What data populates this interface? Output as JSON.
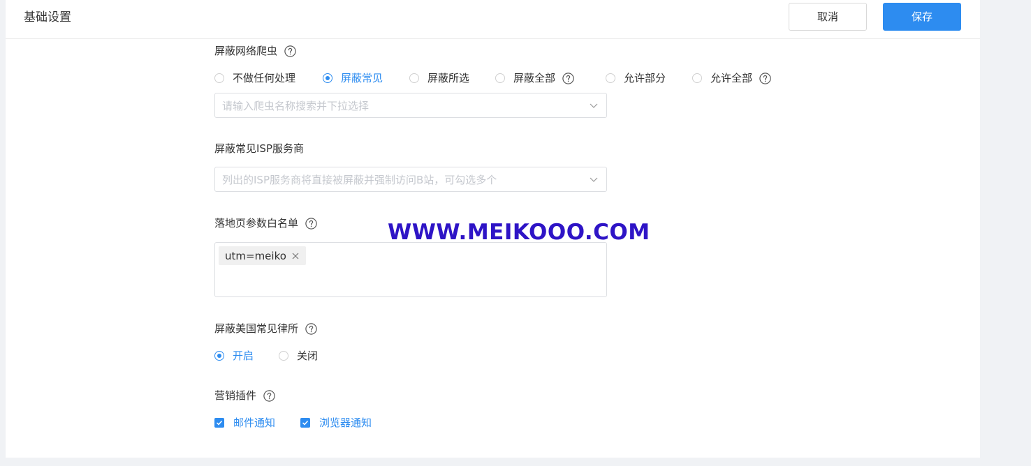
{
  "header": {
    "title": "基础设置",
    "cancel_label": "取消",
    "save_label": "保存"
  },
  "crawler": {
    "label": "屏蔽网络爬虫",
    "options": [
      "不做任何处理",
      "屏蔽常见",
      "屏蔽所选",
      "屏蔽全部",
      "允许部分",
      "允许全部"
    ],
    "selected": "屏蔽常见",
    "select_placeholder": "请输入爬虫名称搜索并下拉选择"
  },
  "isp": {
    "label": "屏蔽常见ISP服务商",
    "select_placeholder": "列出的ISP服务商将直接被屏蔽并强制访问B站，可勾选多个"
  },
  "whitelist": {
    "label": "落地页参数白名单",
    "tags": [
      "utm=meiko"
    ]
  },
  "law_firm": {
    "label": "屏蔽美国常见律所",
    "options": [
      "开启",
      "关闭"
    ],
    "selected": "开启"
  },
  "marketing": {
    "label": "营销插件",
    "options": [
      "邮件通知",
      "浏览器通知"
    ],
    "checked": [
      "邮件通知",
      "浏览器通知"
    ]
  },
  "watermark": "WWW.MEIKOOO.COM",
  "colors": {
    "accent": "#2d8cf0",
    "watermark": "#2e14c6",
    "placeholder": "#c5c8ce"
  }
}
